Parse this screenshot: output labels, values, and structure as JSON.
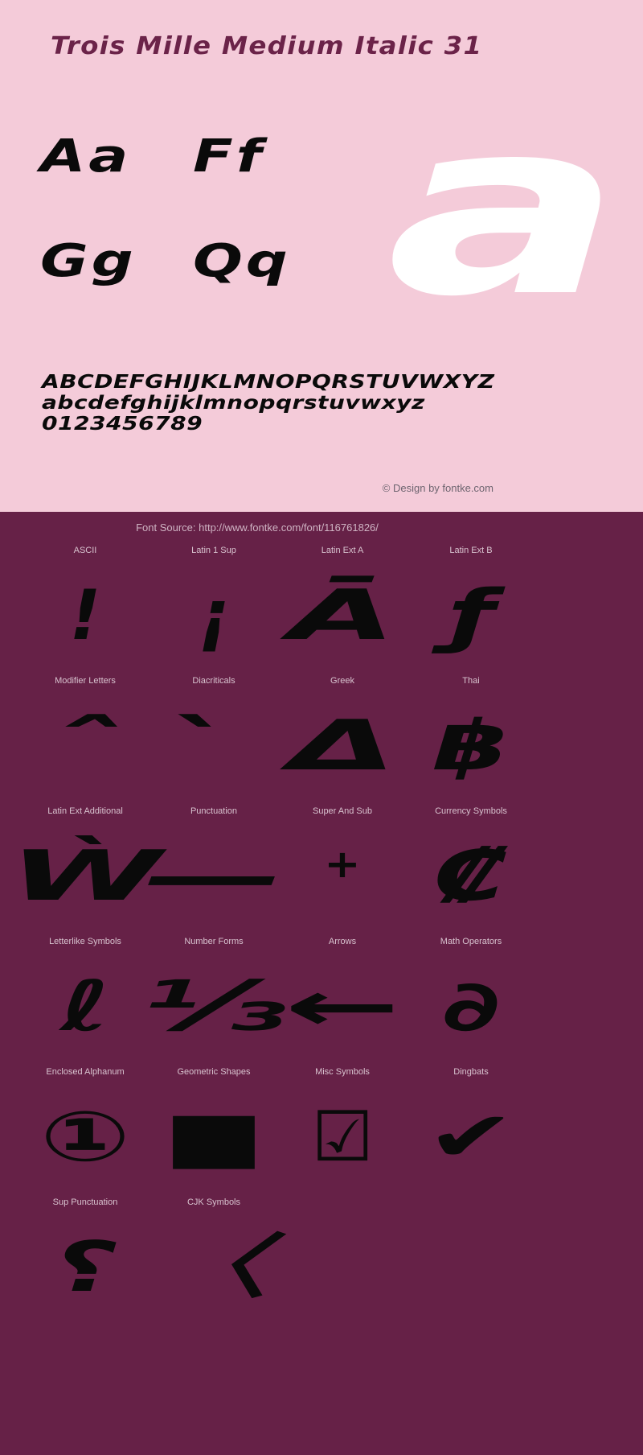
{
  "colors": {
    "specimen_bg": "#f4cbd9",
    "panel_bg": "#662147",
    "title": "#6b2349",
    "glyph": "#0a0a0a",
    "big_glyph": "#ffffff",
    "label": "#d8c3cf",
    "credit": "#6e6570"
  },
  "specimen": {
    "title": "Trois Mille Medium Italic 31",
    "big_glyph": "a",
    "pairs": [
      [
        "Aa",
        "Ff"
      ],
      [
        "Gg",
        "Qq"
      ]
    ],
    "alphabet_upper": "ABCDEFGHIJKLMNOPQRSTUVWXYZ",
    "alphabet_lower": "abcdefghijklmnopqrstuvwxyz",
    "digits": "0123456789",
    "credit": "© Design by fontke.com"
  },
  "blocks": {
    "source": "Font Source: http://www.fontke.com/font/116761826/",
    "rows": [
      [
        {
          "label": "ASCII",
          "glyph": "!"
        },
        {
          "label": "Latin 1 Sup",
          "glyph": "¡"
        },
        {
          "label": "Latin Ext A",
          "glyph": "Ā"
        },
        {
          "label": "Latin Ext B",
          "glyph": "ƒ"
        }
      ],
      [
        {
          "label": "Modifier Letters",
          "glyph": "ˆ"
        },
        {
          "label": "Diacriticals",
          "glyph": "̀"
        },
        {
          "label": "Greek",
          "glyph": "Δ"
        },
        {
          "label": "Thai",
          "glyph": "฿"
        }
      ],
      [
        {
          "label": "Latin Ext Additional",
          "glyph": "Ẁ"
        },
        {
          "label": "Punctuation",
          "glyph": "—"
        },
        {
          "label": "Super And Sub",
          "glyph": "⁺"
        },
        {
          "label": "Currency Symbols",
          "glyph": "₡"
        }
      ],
      [
        {
          "label": "Letterlike Symbols",
          "glyph": "ℓ"
        },
        {
          "label": "Number Forms",
          "glyph": "⅓"
        },
        {
          "label": "Arrows",
          "glyph": "←"
        },
        {
          "label": "Math Operators",
          "glyph": "∂"
        }
      ],
      [
        {
          "label": "Enclosed Alphanum",
          "glyph": "①"
        },
        {
          "label": "Geometric Shapes",
          "glyph": "■"
        },
        {
          "label": "Misc Symbols",
          "glyph": "☑"
        },
        {
          "label": "Dingbats",
          "glyph": "✔"
        }
      ],
      [
        {
          "label": "Sup Punctuation",
          "glyph": "⸮"
        },
        {
          "label": "CJK Symbols",
          "glyph": "〈"
        },
        {
          "label": "",
          "glyph": ""
        },
        {
          "label": "",
          "glyph": ""
        }
      ]
    ]
  }
}
